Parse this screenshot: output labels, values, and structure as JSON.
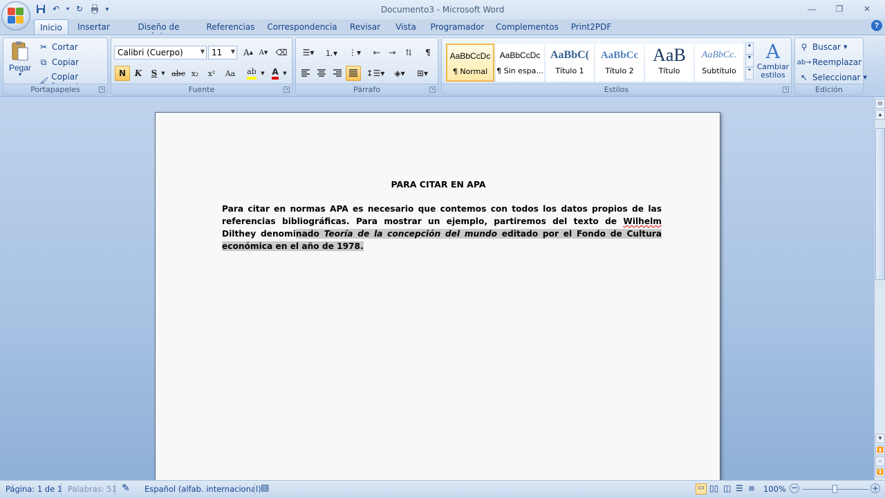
{
  "window": {
    "title": "Documento3 - Microsoft Word"
  },
  "tabs": [
    "Inicio",
    "Insertar",
    "Diseño de página",
    "Referencias",
    "Correspondencia",
    "Revisar",
    "Vista",
    "Programador",
    "Complementos",
    "Print2PDF"
  ],
  "clipboard": {
    "paste": "Pegar",
    "cut": "Cortar",
    "copy": "Copiar",
    "format_painter": "Copiar formato",
    "label": "Portapapeles"
  },
  "font": {
    "name": "Calibri (Cuerpo)",
    "size": "11",
    "label": "Fuente",
    "bold": "N",
    "italic": "K",
    "underline": "S",
    "strike": "abc",
    "sub": "x₂",
    "sup": "x²",
    "case": "Aa"
  },
  "paragraph": {
    "label": "Párrafo"
  },
  "styles": {
    "label": "Estilos",
    "items": [
      {
        "preview": "AaBbCcDc",
        "name": "¶ Normal"
      },
      {
        "preview": "AaBbCcDc",
        "name": "¶ Sin espa..."
      },
      {
        "preview": "AaBbC(",
        "name": "Título 1"
      },
      {
        "preview": "AaBbCc",
        "name": "Título 2"
      },
      {
        "preview": "AaB",
        "name": "Título"
      },
      {
        "preview": "AaBbCc.",
        "name": "Subtítulo"
      }
    ],
    "change": "Cambiar estilos"
  },
  "editing": {
    "label": "Edición",
    "find": "Buscar",
    "replace": "Reemplazar",
    "select": "Seleccionar"
  },
  "document": {
    "title": "PARA CITAR EN APA",
    "p1": "Para citar en normas APA es necesario que contemos con todos los datos propios de las referencias bibliográficas. Para mostrar un ejemplo, partiremos del texto de ",
    "author": "Wilhelm",
    "p2": " Dilthey denomi",
    "p3": "nado ",
    "italic_title": "Teoría de la concepción del mundo",
    "p4": " editado por el Fondo de Cultura económica en el año de 1978."
  },
  "statusbar": {
    "page": "Página: 1 de 1",
    "words": "Palabras: 51",
    "language": "Español (alfab. internacional)",
    "zoom": "100%"
  },
  "colors": {
    "accent": "#15428b",
    "ribbon": "#c4d7ee",
    "highlight": "#f9c55b",
    "font_color": "#e00000",
    "highlight_color": "#ffff00"
  }
}
